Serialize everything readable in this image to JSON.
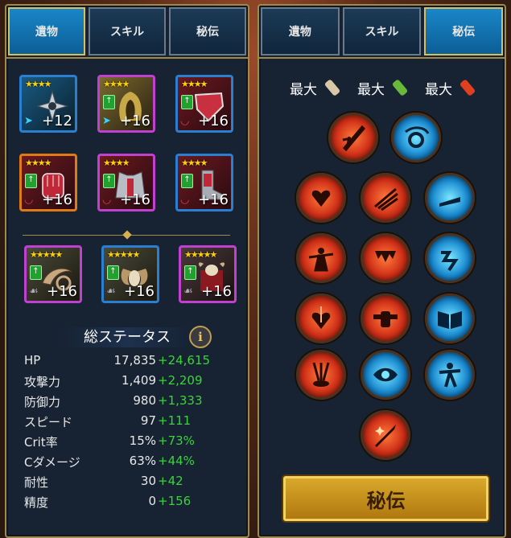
{
  "left_tabs": [
    "遺物",
    "スキル",
    "秘伝"
  ],
  "right_tabs": [
    "遺物",
    "スキル",
    "秘伝"
  ],
  "items": [
    {
      "stars": "★★★★",
      "level": "+12",
      "frame": "blue"
    },
    {
      "stars": "★★★★",
      "level": "+16",
      "frame": "purple"
    },
    {
      "stars": "★★★★",
      "level": "+16",
      "frame": "blue"
    },
    {
      "stars": "★★★★",
      "level": "+16",
      "frame": "orange"
    },
    {
      "stars": "★★★★",
      "level": "+16",
      "frame": "purple"
    },
    {
      "stars": "★★★★",
      "level": "+16",
      "frame": "blue"
    }
  ],
  "accessories": [
    {
      "stars": "★★★★★",
      "level": "+16",
      "frame": "purple"
    },
    {
      "stars": "★★★★★",
      "level": "+16",
      "frame": "blue"
    },
    {
      "stars": "★★★★★",
      "level": "+16",
      "frame": "purple"
    }
  ],
  "status": {
    "title": "総ステータス",
    "info_icon": "i",
    "rows": [
      {
        "name": "HP",
        "base": "17,835",
        "bonus": "+24,615"
      },
      {
        "name": "攻撃力",
        "base": "1,409",
        "bonus": "+2,209"
      },
      {
        "name": "防御力",
        "base": "980",
        "bonus": "+1,333"
      },
      {
        "name": "スピード",
        "base": "97",
        "bonus": "+111"
      },
      {
        "name": "Crit率",
        "base": "15%",
        "bonus": "+73%"
      },
      {
        "name": "Cダメージ",
        "base": "63%",
        "bonus": "+44%"
      },
      {
        "name": "耐性",
        "base": "30",
        "bonus": "+42"
      },
      {
        "name": "精度",
        "base": "0",
        "bonus": "+156"
      }
    ]
  },
  "mastery": {
    "max_labels": [
      "最大",
      "最大",
      "最大"
    ],
    "action_button": "秘伝",
    "scroll_colors": [
      "#d8c8a8",
      "#6ab83a",
      "#e04020"
    ]
  },
  "colors": {
    "accent_gold": "#a08a4a",
    "tab_active": "#1a86c8",
    "bonus_green": "#3ad43a"
  }
}
